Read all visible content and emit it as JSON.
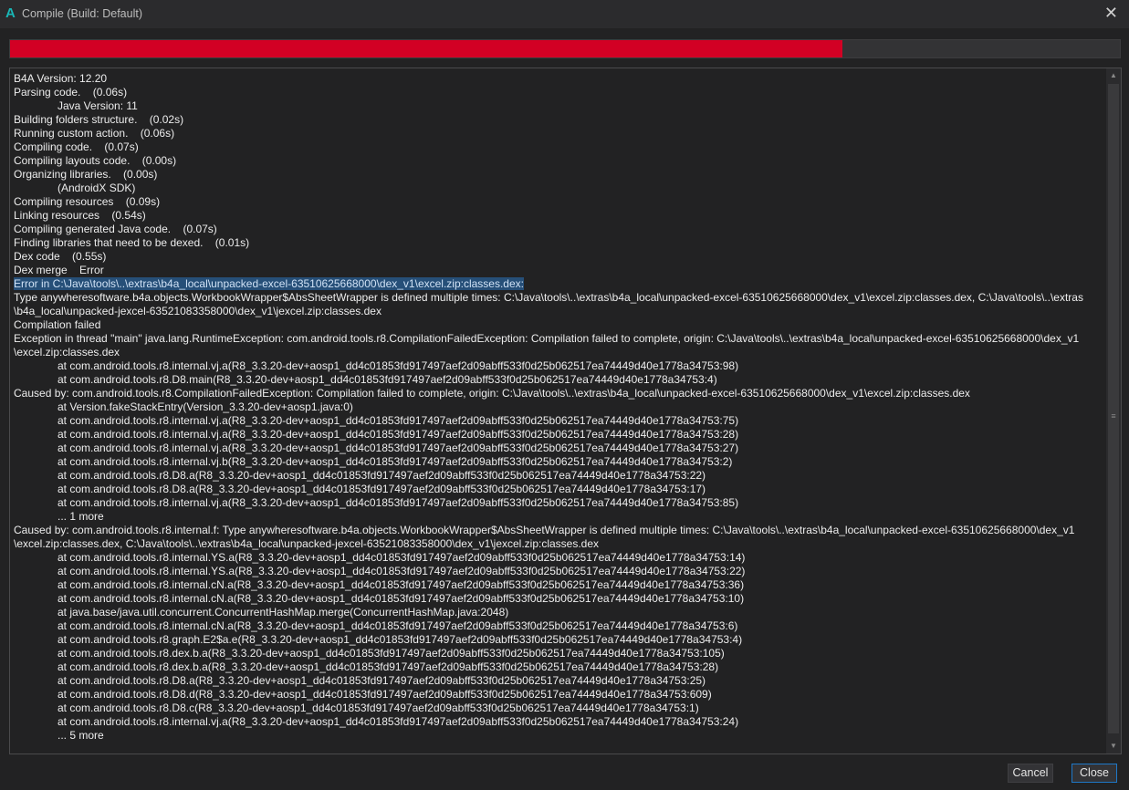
{
  "window": {
    "title": "Compile (Build: Default)",
    "app_icon": "A",
    "close_icon": "✕"
  },
  "progress": {
    "percent": 75,
    "color": "#d20024"
  },
  "log": {
    "lines": [
      {
        "text": "B4A Version: 12.20"
      },
      {
        "text": "Parsing code.    (0.06s)"
      },
      {
        "text": "Java Version: 11",
        "indent": true
      },
      {
        "text": "Building folders structure.    (0.02s)"
      },
      {
        "text": "Running custom action.    (0.06s)"
      },
      {
        "text": "Compiling code.    (0.07s)"
      },
      {
        "text": "Compiling layouts code.    (0.00s)"
      },
      {
        "text": "Organizing libraries.    (0.00s)"
      },
      {
        "text": "(AndroidX SDK)",
        "indent": true
      },
      {
        "text": "Compiling resources    (0.09s)"
      },
      {
        "text": "Linking resources    (0.54s)"
      },
      {
        "text": "Compiling generated Java code.    (0.07s)"
      },
      {
        "text": "Finding libraries that need to be dexed.    (0.01s)"
      },
      {
        "text": "Dex code    (0.55s)"
      },
      {
        "text": "Dex merge    Error"
      },
      {
        "text": "Error in C:\\Java\\tools\\..\\extras\\b4a_local\\unpacked-excel-63510625668000\\dex_v1\\excel.zip:classes.dex:",
        "selected": true
      },
      {
        "text": "Type anywheresoftware.b4a.objects.WorkbookWrapper$AbsSheetWrapper is defined multiple times: C:\\Java\\tools\\..\\extras\\b4a_local\\unpacked-excel-63510625668000\\dex_v1\\excel.zip:classes.dex, C:\\Java\\tools\\..\\extras"
      },
      {
        "text": "\\b4a_local\\unpacked-jexcel-63521083358000\\dex_v1\\jexcel.zip:classes.dex"
      },
      {
        "text": "Compilation failed"
      },
      {
        "text": "Exception in thread \"main\" java.lang.RuntimeException: com.android.tools.r8.CompilationFailedException: Compilation failed to complete, origin: C:\\Java\\tools\\..\\extras\\b4a_local\\unpacked-excel-63510625668000\\dex_v1"
      },
      {
        "text": "\\excel.zip:classes.dex"
      },
      {
        "text": "at com.android.tools.r8.internal.vj.a(R8_3.3.20-dev+aosp1_dd4c01853fd917497aef2d09abff533f0d25b062517ea74449d40e1778a34753:98)",
        "indent": true
      },
      {
        "text": "at com.android.tools.r8.D8.main(R8_3.3.20-dev+aosp1_dd4c01853fd917497aef2d09abff533f0d25b062517ea74449d40e1778a34753:4)",
        "indent": true
      },
      {
        "text": "Caused by: com.android.tools.r8.CompilationFailedException: Compilation failed to complete, origin: C:\\Java\\tools\\..\\extras\\b4a_local\\unpacked-excel-63510625668000\\dex_v1\\excel.zip:classes.dex"
      },
      {
        "text": "at Version.fakeStackEntry(Version_3.3.20-dev+aosp1.java:0)",
        "indent": true
      },
      {
        "text": "at com.android.tools.r8.internal.vj.a(R8_3.3.20-dev+aosp1_dd4c01853fd917497aef2d09abff533f0d25b062517ea74449d40e1778a34753:75)",
        "indent": true
      },
      {
        "text": "at com.android.tools.r8.internal.vj.a(R8_3.3.20-dev+aosp1_dd4c01853fd917497aef2d09abff533f0d25b062517ea74449d40e1778a34753:28)",
        "indent": true
      },
      {
        "text": "at com.android.tools.r8.internal.vj.a(R8_3.3.20-dev+aosp1_dd4c01853fd917497aef2d09abff533f0d25b062517ea74449d40e1778a34753:27)",
        "indent": true
      },
      {
        "text": "at com.android.tools.r8.internal.vj.b(R8_3.3.20-dev+aosp1_dd4c01853fd917497aef2d09abff533f0d25b062517ea74449d40e1778a34753:2)",
        "indent": true
      },
      {
        "text": "at com.android.tools.r8.D8.a(R8_3.3.20-dev+aosp1_dd4c01853fd917497aef2d09abff533f0d25b062517ea74449d40e1778a34753:22)",
        "indent": true
      },
      {
        "text": "at com.android.tools.r8.D8.a(R8_3.3.20-dev+aosp1_dd4c01853fd917497aef2d09abff533f0d25b062517ea74449d40e1778a34753:17)",
        "indent": true
      },
      {
        "text": "at com.android.tools.r8.internal.vj.a(R8_3.3.20-dev+aosp1_dd4c01853fd917497aef2d09abff533f0d25b062517ea74449d40e1778a34753:85)",
        "indent": true
      },
      {
        "text": "... 1 more",
        "indent": true
      },
      {
        "text": "Caused by: com.android.tools.r8.internal.f: Type anywheresoftware.b4a.objects.WorkbookWrapper$AbsSheetWrapper is defined multiple times: C:\\Java\\tools\\..\\extras\\b4a_local\\unpacked-excel-63510625668000\\dex_v1"
      },
      {
        "text": "\\excel.zip:classes.dex, C:\\Java\\tools\\..\\extras\\b4a_local\\unpacked-jexcel-63521083358000\\dex_v1\\jexcel.zip:classes.dex"
      },
      {
        "text": "at com.android.tools.r8.internal.YS.a(R8_3.3.20-dev+aosp1_dd4c01853fd917497aef2d09abff533f0d25b062517ea74449d40e1778a34753:14)",
        "indent": true
      },
      {
        "text": "at com.android.tools.r8.internal.YS.a(R8_3.3.20-dev+aosp1_dd4c01853fd917497aef2d09abff533f0d25b062517ea74449d40e1778a34753:22)",
        "indent": true
      },
      {
        "text": "at com.android.tools.r8.internal.cN.a(R8_3.3.20-dev+aosp1_dd4c01853fd917497aef2d09abff533f0d25b062517ea74449d40e1778a34753:36)",
        "indent": true
      },
      {
        "text": "at com.android.tools.r8.internal.cN.a(R8_3.3.20-dev+aosp1_dd4c01853fd917497aef2d09abff533f0d25b062517ea74449d40e1778a34753:10)",
        "indent": true
      },
      {
        "text": "at java.base/java.util.concurrent.ConcurrentHashMap.merge(ConcurrentHashMap.java:2048)",
        "indent": true
      },
      {
        "text": "at com.android.tools.r8.internal.cN.a(R8_3.3.20-dev+aosp1_dd4c01853fd917497aef2d09abff533f0d25b062517ea74449d40e1778a34753:6)",
        "indent": true
      },
      {
        "text": "at com.android.tools.r8.graph.E2$a.e(R8_3.3.20-dev+aosp1_dd4c01853fd917497aef2d09abff533f0d25b062517ea74449d40e1778a34753:4)",
        "indent": true
      },
      {
        "text": "at com.android.tools.r8.dex.b.a(R8_3.3.20-dev+aosp1_dd4c01853fd917497aef2d09abff533f0d25b062517ea74449d40e1778a34753:105)",
        "indent": true
      },
      {
        "text": "at com.android.tools.r8.dex.b.a(R8_3.3.20-dev+aosp1_dd4c01853fd917497aef2d09abff533f0d25b062517ea74449d40e1778a34753:28)",
        "indent": true
      },
      {
        "text": "at com.android.tools.r8.D8.a(R8_3.3.20-dev+aosp1_dd4c01853fd917497aef2d09abff533f0d25b062517ea74449d40e1778a34753:25)",
        "indent": true
      },
      {
        "text": "at com.android.tools.r8.D8.d(R8_3.3.20-dev+aosp1_dd4c01853fd917497aef2d09abff533f0d25b062517ea74449d40e1778a34753:609)",
        "indent": true
      },
      {
        "text": "at com.android.tools.r8.D8.c(R8_3.3.20-dev+aosp1_dd4c01853fd917497aef2d09abff533f0d25b062517ea74449d40e1778a34753:1)",
        "indent": true
      },
      {
        "text": "at com.android.tools.r8.internal.vj.a(R8_3.3.20-dev+aosp1_dd4c01853fd917497aef2d09abff533f0d25b062517ea74449d40e1778a34753:24)",
        "indent": true
      },
      {
        "text": "... 5 more",
        "indent": true
      }
    ]
  },
  "buttons": {
    "cancel": "Cancel",
    "close": "Close"
  }
}
